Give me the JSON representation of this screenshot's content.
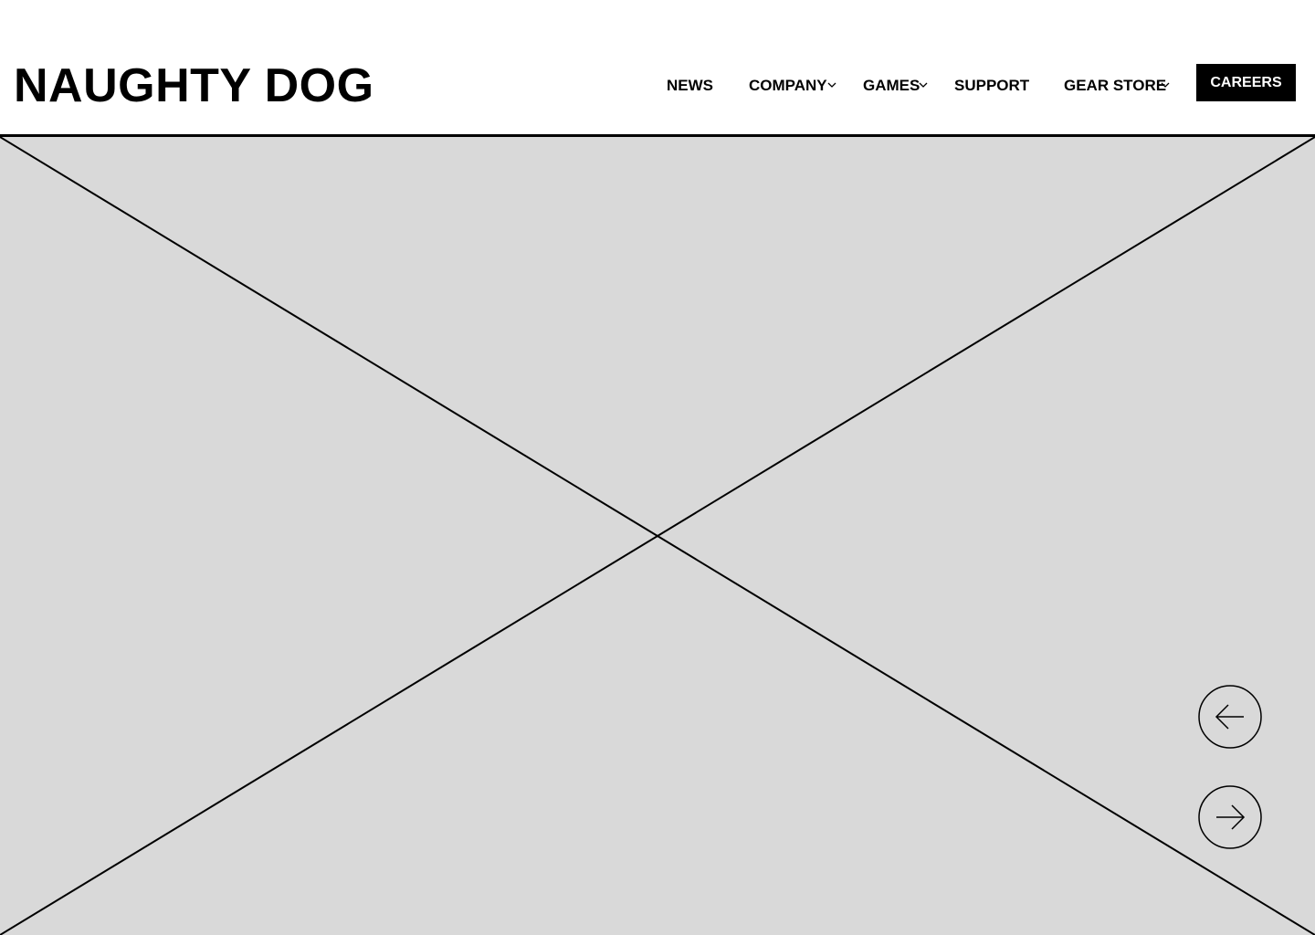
{
  "header": {
    "logo_text": "NAUGHTY DOG",
    "nav": [
      {
        "label": "NEWS",
        "has_dropdown": false
      },
      {
        "label": "COMPANY",
        "has_dropdown": true
      },
      {
        "label": "GAMES",
        "has_dropdown": true
      },
      {
        "label": "SUPPORT",
        "has_dropdown": false
      },
      {
        "label": "GEAR STORE",
        "has_dropdown": true
      }
    ],
    "cta_label": "CAREERS"
  },
  "hero": {
    "type": "image-placeholder",
    "background_color": "#d9d9d9",
    "controls": {
      "prev_icon": "arrow-left-icon",
      "next_icon": "arrow-right-icon"
    }
  },
  "colors": {
    "text": "#000000",
    "background": "#ffffff",
    "cta_background": "#000000",
    "cta_text": "#ffffff"
  }
}
